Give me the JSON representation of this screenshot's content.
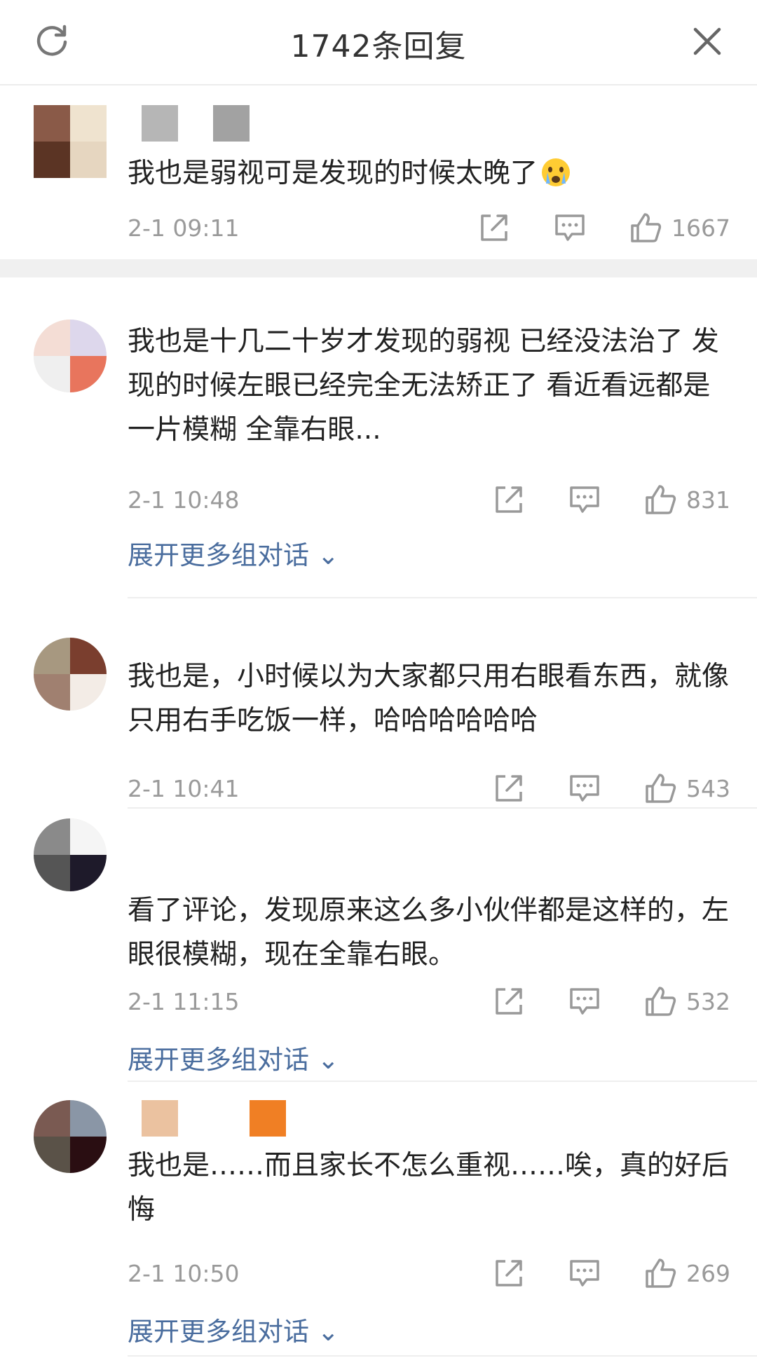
{
  "header": {
    "title": "1742条回复",
    "refresh_icon": "refresh-icon",
    "close_icon": "close-icon"
  },
  "comments": [
    {
      "text": "我也是弱视可是发现的时候太晚了",
      "emoji": "crying-face-icon",
      "time": "2-1 09:11",
      "likes": "1667",
      "expand": ""
    },
    {
      "text": "我也是十几二十岁才发现的弱视 已经没法治了 发现的时候左眼已经完全无法矫正了 看近看远都是一片模糊 全靠右眼...",
      "time": "2-1 10:48",
      "likes": "831",
      "expand": "展开更多组对话"
    },
    {
      "text": "我也是，小时候以为大家都只用右眼看东西，就像只用右手吃饭一样，哈哈哈哈哈哈",
      "time": "2-1 10:41",
      "likes": "543",
      "expand": ""
    },
    {
      "text": "看了评论，发现原来这么多小伙伴都是这样的，左眼很模糊，现在全靠右眼。",
      "time": "2-1 11:15",
      "likes": "532",
      "expand": "展开更多组对话"
    },
    {
      "text": "我也是……而且家长不怎么重视……唉，真的好后悔",
      "time": "2-1 10:50",
      "likes": "269",
      "expand": "展开更多组对话"
    }
  ],
  "colors": {
    "link": "#4a6d9e",
    "meta_gray": "#9a9a9a",
    "text": "#222222"
  }
}
